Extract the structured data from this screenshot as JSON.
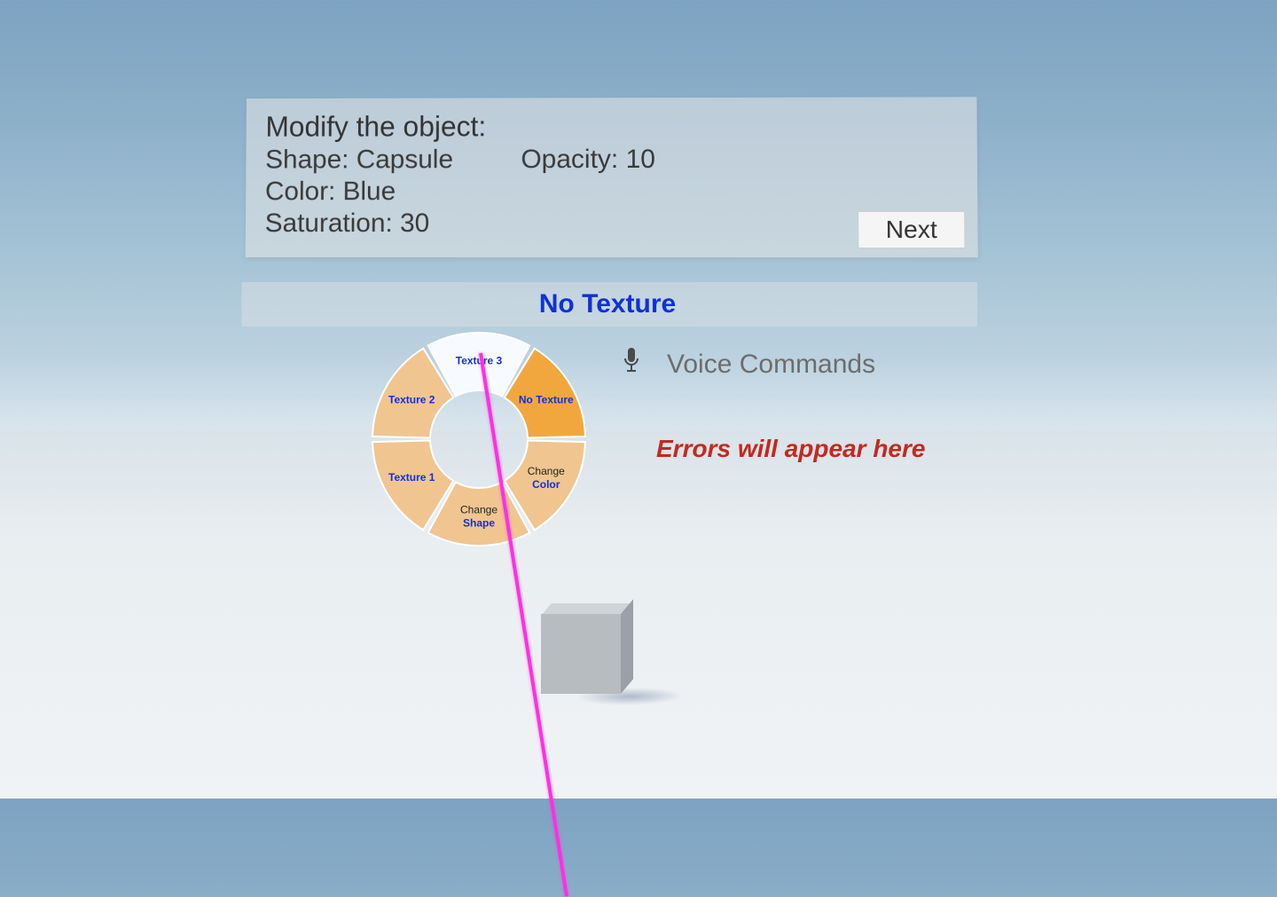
{
  "instruction": {
    "title": "Modify the object:",
    "shape_label": "Shape:",
    "shape_value": "Capsule",
    "opacity_label": "Opacity:",
    "opacity_value": "10",
    "color_label": "Color:",
    "color_value": "Blue",
    "saturation_label": "Saturation:",
    "saturation_value": "30",
    "next_button": "Next"
  },
  "status": {
    "current_texture": "No Texture"
  },
  "voice": {
    "label": "Voice Commands"
  },
  "errors": {
    "placeholder": "Errors will appear here"
  },
  "radial_menu": {
    "items": [
      {
        "label": "Texture 3",
        "state": "hover"
      },
      {
        "label": "No Texture",
        "state": "active"
      },
      {
        "label_top": "Change",
        "label": "Color",
        "state": "normal"
      },
      {
        "label_top": "Change",
        "label": "Shape",
        "state": "normal"
      },
      {
        "label": "Texture 1",
        "state": "normal"
      },
      {
        "label": "Texture 2",
        "state": "normal"
      }
    ]
  },
  "colors": {
    "accent_blue": "#1030d8",
    "error_red": "#c22a1f",
    "wedge_normal": "#f1c590",
    "wedge_hover": "#f7fbff",
    "wedge_active": "#f2a73e",
    "ray": "#ff2fe2"
  }
}
